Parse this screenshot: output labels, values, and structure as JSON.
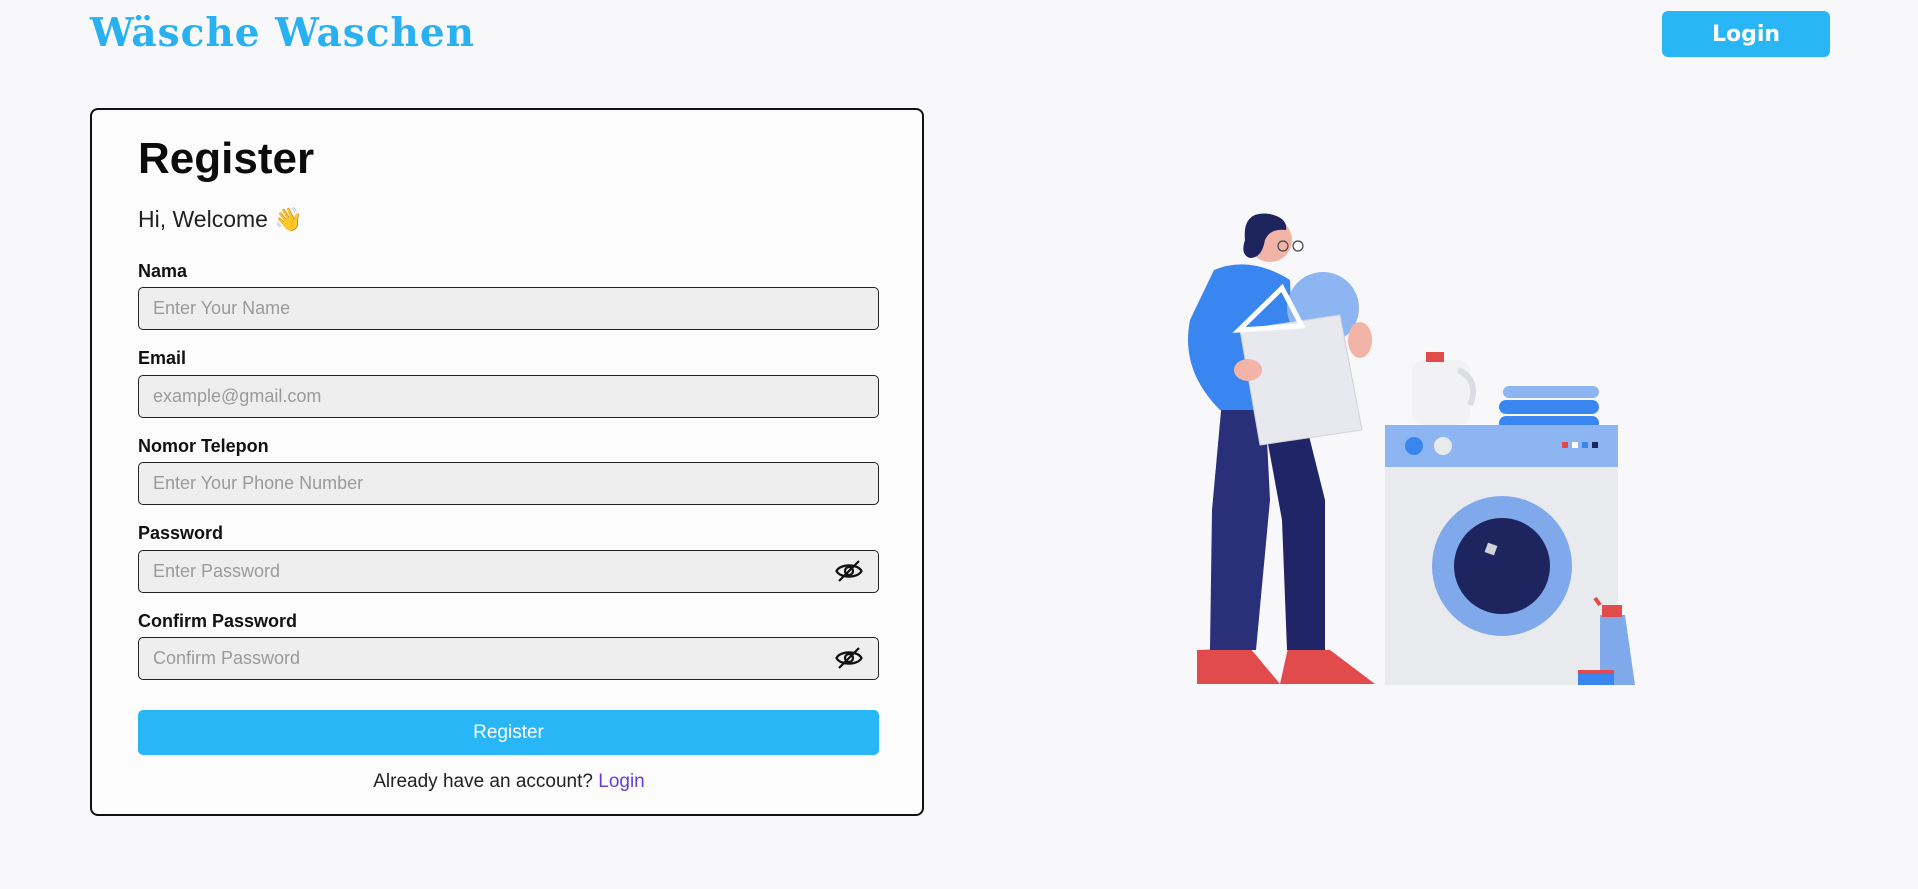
{
  "header": {
    "brand": "Wäsche Waschen",
    "login_label": "Login"
  },
  "form": {
    "title": "Register",
    "welcome": "Hi, Welcome 👋",
    "fields": [
      {
        "label": "Nama",
        "placeholder": "Enter Your Name",
        "value": ""
      },
      {
        "label": "Email",
        "placeholder": "example@gmail.com",
        "value": ""
      },
      {
        "label": "Nomor Telepon",
        "placeholder": "Enter Your Phone Number",
        "value": ""
      },
      {
        "label": "Password",
        "placeholder": "Enter Password",
        "value": "",
        "icon": "eye-slash-icon"
      },
      {
        "label": "Confirm Password",
        "placeholder": "Confirm Password",
        "value": "",
        "icon": "eye-slash-icon"
      }
    ],
    "submit_label": "Register",
    "footer_text": "Already have an account?",
    "footer_link": "Login"
  },
  "colors": {
    "accent": "#29b6f6",
    "link": "#6a3fd8",
    "brand": "#29b0f0"
  }
}
